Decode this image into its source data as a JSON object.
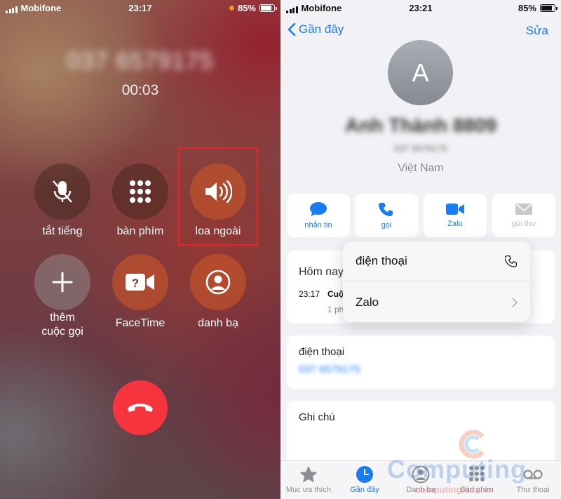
{
  "call_screen": {
    "status_bar": {
      "carrier": "Mobifone",
      "time": "23:17",
      "battery": "85%"
    },
    "caller_number": "037 6579175",
    "duration": "00:03",
    "buttons": [
      {
        "label": "tắt tiếng",
        "icon": "mute-mic-icon"
      },
      {
        "label": "bàn phím",
        "icon": "keypad-icon"
      },
      {
        "label": "loa ngoài",
        "icon": "speaker-icon",
        "highlighted": true
      },
      {
        "label": "thêm cuộc gọi",
        "label_line1": "thêm",
        "label_line2": "cuộc gọi",
        "icon": "plus-icon"
      },
      {
        "label": "FaceTime",
        "icon": "facetime-icon"
      },
      {
        "label": "danh bạ",
        "icon": "contacts-icon"
      }
    ],
    "end_call_icon": "end-call-icon"
  },
  "contact_screen": {
    "status_bar": {
      "carrier": "Mobifone",
      "time": "23:21",
      "battery": "85%"
    },
    "nav": {
      "back_label": "Gần đây",
      "edit_label": "Sửa"
    },
    "avatar_initial": "A",
    "contact_name": "Anh Thành 8809",
    "contact_number": "037 6579175",
    "country": "Việt Nam",
    "actions": [
      {
        "label": "nhắn tin",
        "icon": "message-icon"
      },
      {
        "label": "gọi",
        "icon": "phone-icon"
      },
      {
        "label": "Zalo",
        "icon": "video-icon"
      },
      {
        "label": "gửi thư",
        "icon": "mail-icon",
        "disabled": true
      }
    ],
    "recent": {
      "day": "Hôm nay",
      "time": "23:17",
      "call_type": "Cuộ",
      "call_length": "1 ph"
    },
    "phone_card": {
      "label": "điện thoại",
      "number": "037 6579175"
    },
    "note_card": {
      "label": "Ghi chú"
    },
    "popup": {
      "option1": "điện thoại",
      "option2": "Zalo"
    },
    "tabs": [
      {
        "label": "Mục ưa thích",
        "icon": "star-icon"
      },
      {
        "label": "Gần đây",
        "icon": "clock-icon",
        "active": true
      },
      {
        "label": "Danh bạ",
        "icon": "contacts-icon"
      },
      {
        "label": "Bàn phím",
        "icon": "keypad-icon"
      },
      {
        "label": "Thư thoại",
        "icon": "voicemail-icon"
      }
    ],
    "watermark": {
      "brand": "Computing",
      "site": "computing.edu.vn"
    }
  },
  "colors": {
    "accent": "#1a7cf3",
    "end_call": "#f5343d",
    "highlight": "#e8242a"
  }
}
